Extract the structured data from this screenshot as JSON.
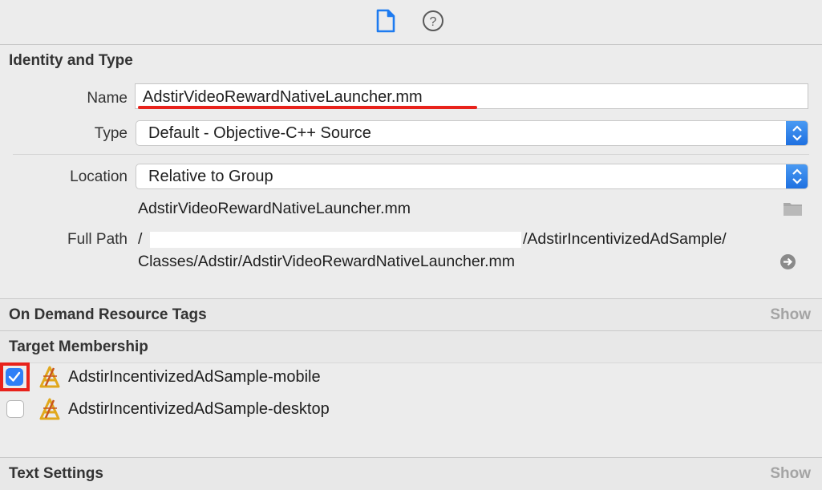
{
  "toolbar": {
    "icons": [
      "file-inspector-icon",
      "quick-help-icon"
    ]
  },
  "identity": {
    "section_title": "Identity and Type",
    "name_label": "Name",
    "name_value": "AdstirVideoRewardNativeLauncher.mm",
    "type_label": "Type",
    "type_value": "Default - Objective-C++ Source",
    "location_label": "Location",
    "location_value": "Relative to Group",
    "location_filename": "AdstirVideoRewardNativeLauncher.mm",
    "full_path_label": "Full Path",
    "full_path_prefix": "/",
    "full_path_line1": "/AdstirIncentivizedAdSample/",
    "full_path_line2": "Classes/Adstir/AdstirVideoRewardNativeLauncher.mm"
  },
  "on_demand": {
    "section_title": "On Demand Resource Tags",
    "show_label": "Show"
  },
  "target_membership": {
    "section_title": "Target Membership",
    "targets": [
      {
        "label": "AdstirIncentivizedAdSample-mobile",
        "checked": true
      },
      {
        "label": "AdstirIncentivizedAdSample-desktop",
        "checked": false
      }
    ]
  },
  "text_settings": {
    "section_title": "Text Settings",
    "show_label": "Show"
  },
  "colors": {
    "accent": "#2f7ff7",
    "annotation_red": "#e8221b"
  }
}
